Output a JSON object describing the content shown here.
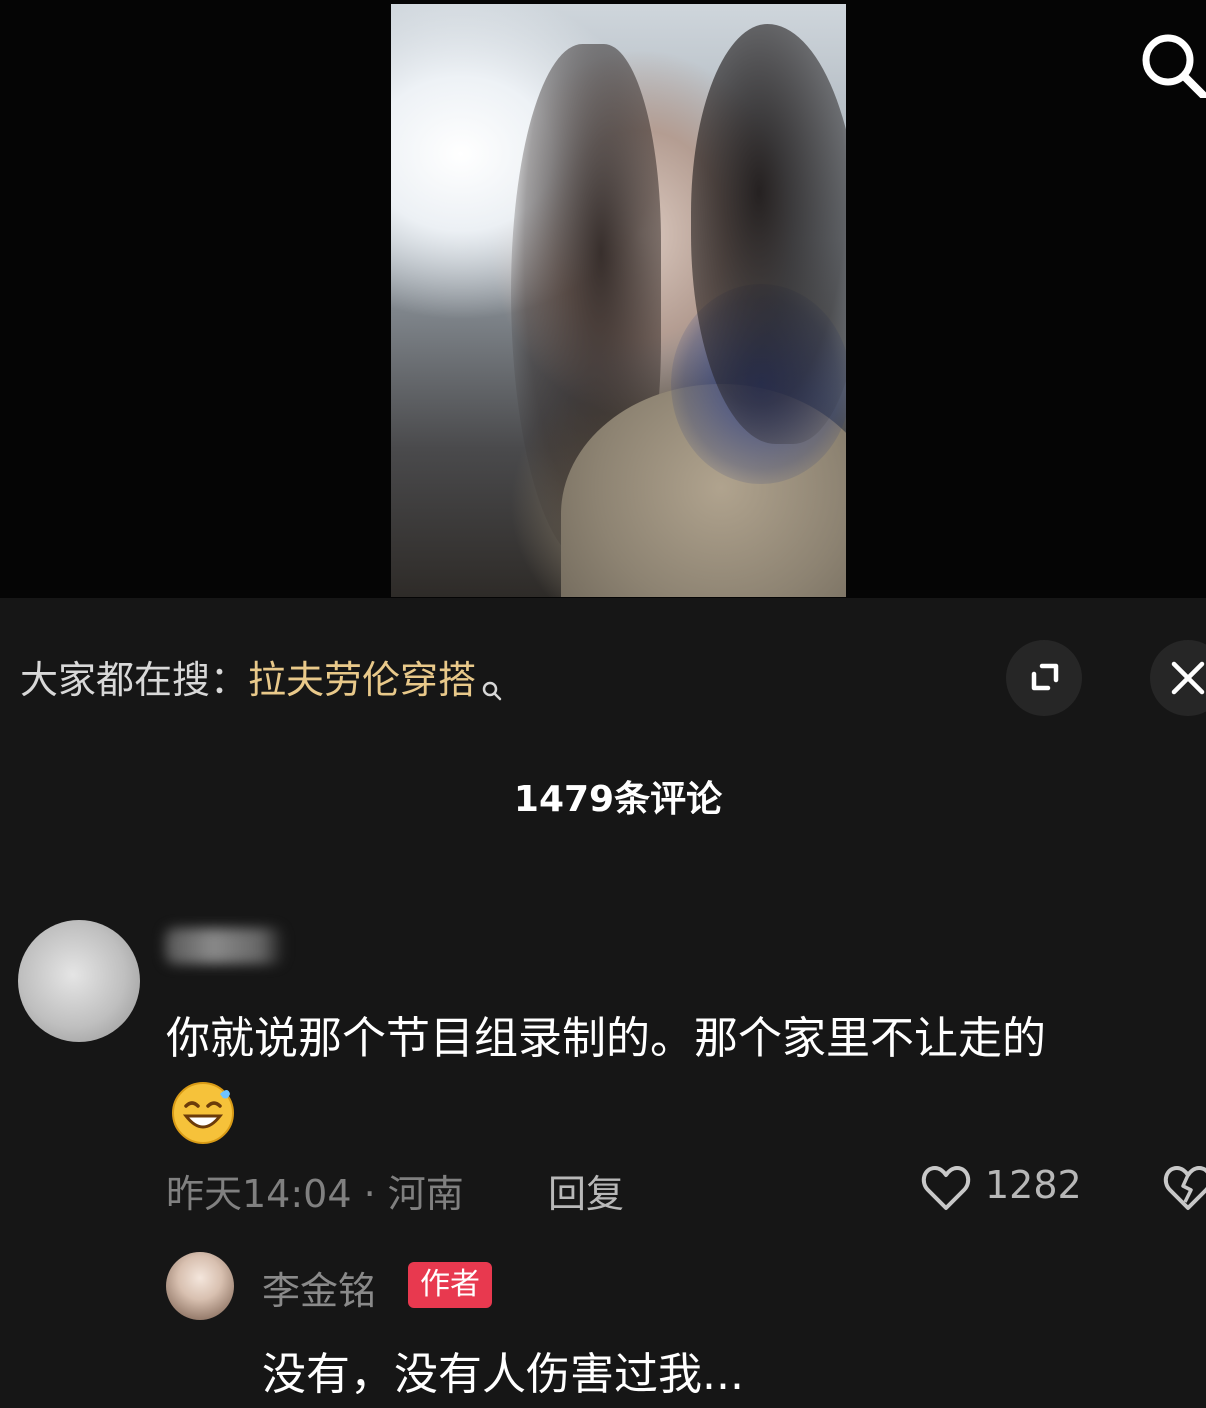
{
  "video": {
    "search_icon": "search-icon"
  },
  "search_hint": {
    "prefix": "大家都在搜：",
    "keyword": "拉夫劳伦穿搭",
    "expand_icon": "expand-icon",
    "close_icon": "close-icon"
  },
  "comments": {
    "title": "1479条评论",
    "items": [
      {
        "text": "你就说那个节目组录制的。那个家里不让走的",
        "emoji": "laugh-cry-emoji",
        "time_location": "昨天14:04 · 河南",
        "reply_label": "回复",
        "like_count": "1282",
        "replies": [
          {
            "author": "李金铭",
            "badge": "作者",
            "text": "没有，没有人伤害过我..."
          }
        ]
      }
    ]
  },
  "colors": {
    "background": "#161616",
    "keyword": "#e9c98a",
    "author_badge": "#e8394f"
  }
}
